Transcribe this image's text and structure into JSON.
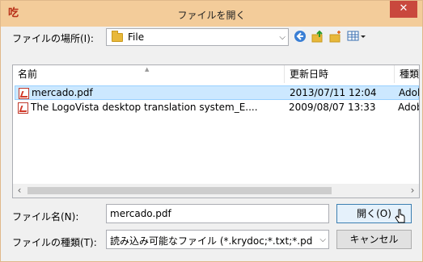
{
  "window": {
    "title": "ファイルを開く",
    "close_glyph": "✕"
  },
  "location": {
    "label": "ファイルの場所(I):",
    "value": "File"
  },
  "file_list": {
    "columns": [
      "名前",
      "更新日時",
      "種類"
    ],
    "rows": [
      {
        "name": "mercado.pdf",
        "modified": "2013/07/11 12:04",
        "type": "Adob",
        "selected": true
      },
      {
        "name": "The LogoVista desktop translation system_E....",
        "modified": "2009/08/07 13:33",
        "type": "Adob",
        "selected": false
      }
    ]
  },
  "filename": {
    "label": "ファイル名(N):",
    "value": "mercado.pdf"
  },
  "filetype": {
    "label": "ファイルの種類(T):",
    "value": "読み込み可能なファイル (*.krydoc;*.txt;*.pdf;"
  },
  "buttons": {
    "open": "開く(O)",
    "cancel": "キャンセル"
  },
  "icons": {
    "app": "logovista-app-icon",
    "back": "back-icon",
    "up": "up-folder-icon",
    "new_folder": "new-folder-icon",
    "view": "view-menu-icon"
  },
  "colors": {
    "titlebar": "#f3cc9a",
    "close": "#c9483d",
    "selection": "#cce8ff"
  }
}
